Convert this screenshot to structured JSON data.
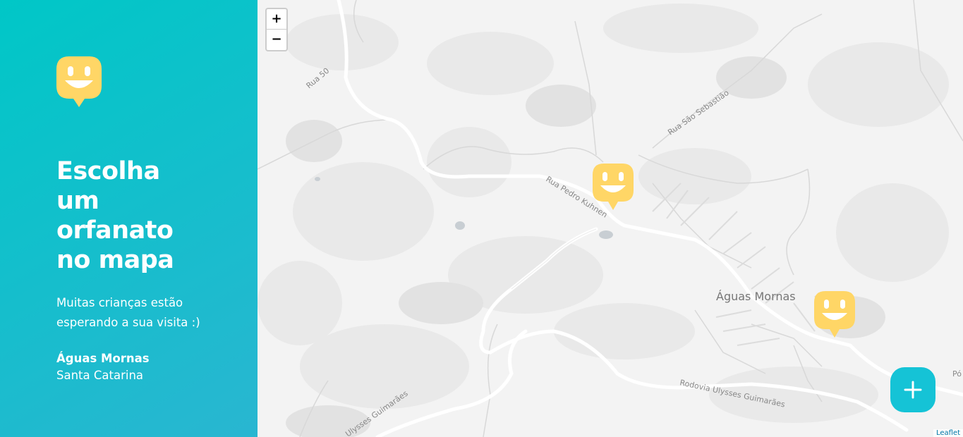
{
  "sidebar": {
    "title_lines": [
      "Escolha",
      "um",
      "orfanato",
      "no mapa"
    ],
    "subtitle_lines": [
      "Muitas crianças estão",
      "esperando a sua visita :)"
    ],
    "city": "Águas Mornas",
    "state": "Santa Catarina",
    "logo_icon": "happy-face-marker-icon"
  },
  "map": {
    "zoom_in_label": "+",
    "zoom_out_label": "−",
    "street_labels": {
      "rua_50": "Rua 50",
      "rua_sao_sebastiao": "Rua São Sebastião",
      "rua_pedro_kuhnen": "Rua Pedro Kuhnen",
      "rodovia_1": "Rodovia Ulysses Guimarães",
      "rodovia_2": "Ulysses Guimarães",
      "town": "Águas Mornas",
      "edge": "Pó"
    },
    "attribution": "Leaflet",
    "marker_icon": "happy-face-marker-icon",
    "marker_count": 2
  },
  "add_button": {
    "icon": "plus-icon"
  },
  "colors": {
    "sidebar_gradient_start": "#00C7C7",
    "sidebar_gradient_end": "#29B6D1",
    "marker": "#FFD666",
    "add_button": "#15C3D6"
  }
}
